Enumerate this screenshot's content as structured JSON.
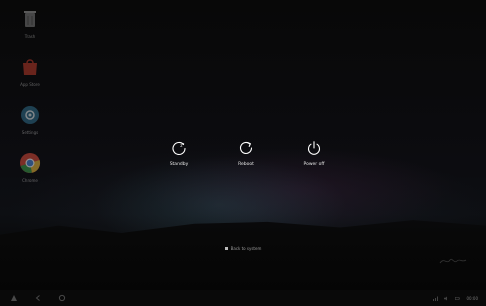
{
  "desktop": {
    "icons": [
      {
        "name": "trash-icon",
        "label": "Trash"
      },
      {
        "name": "app-store-icon",
        "label": "App Store"
      },
      {
        "name": "settings-icon",
        "label": "Settings"
      },
      {
        "name": "chrome-icon",
        "label": "Chrome"
      }
    ]
  },
  "power_menu": {
    "options": [
      {
        "icon": "standby-icon",
        "label": "Standby"
      },
      {
        "icon": "reboot-icon",
        "label": "Reboot"
      },
      {
        "icon": "power-off-icon",
        "label": "Power off"
      }
    ]
  },
  "hint": {
    "text": "Back to system"
  },
  "taskbar": {
    "left_icons": [
      "launcher-icon",
      "back-icon",
      "home-icon"
    ],
    "tray_icons": [
      "network-icon",
      "volume-icon",
      "battery-icon"
    ],
    "clock": "00:00"
  },
  "colors": {
    "background": "#000000",
    "text": "#ffffff"
  }
}
